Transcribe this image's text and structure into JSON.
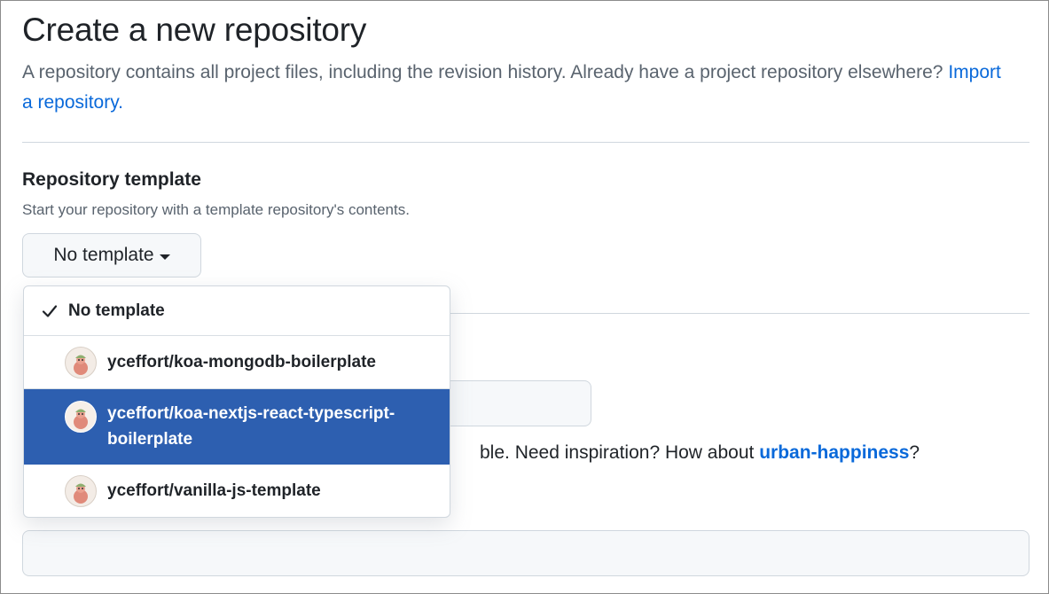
{
  "header": {
    "title": "Create a new repository",
    "description": "A repository contains all project files, including the revision history. Already have a project repository elsewhere?",
    "import_link": "Import a repository."
  },
  "template_section": {
    "title": "Repository template",
    "note": "Start your repository with a template repository's contents.",
    "button_label": "No template"
  },
  "dropdown": {
    "items": [
      {
        "label": "No template",
        "selected": true
      },
      {
        "label": "yceffort/koa-mongodb-boilerplate",
        "avatar": "user-avatar"
      },
      {
        "label_line1": "yceffort/koa-nextjs-react-typescript-",
        "label_line2": "boilerplate",
        "avatar": "user-avatar",
        "highlighted": true
      },
      {
        "label": "yceffort/vanilla-js-template",
        "avatar": "user-avatar"
      }
    ]
  },
  "name_hint": {
    "text": "ble. Need inspiration? How about ",
    "suggestion": "urban-happiness",
    "suffix": "?"
  },
  "colors": {
    "link": "#0969da",
    "highlight": "#2d5fb0",
    "muted_text": "#59636e"
  }
}
